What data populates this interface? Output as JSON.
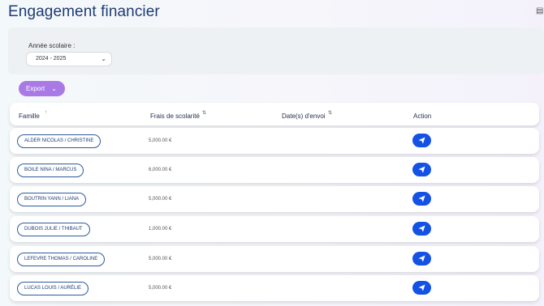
{
  "page": {
    "title": "Engagement financier"
  },
  "filters": {
    "year_label": "Année scolaire :",
    "year_value": "2024 - 2025"
  },
  "toolbar": {
    "export_label": "Export"
  },
  "table": {
    "headers": {
      "family": "Famille",
      "fees": "Frais de scolarité",
      "dates": "Date(s) d'envoi",
      "action": "Action"
    },
    "rows": [
      {
        "family": "ALDER NICOLAS / CHRISTINE",
        "fee": "5,000.00 €"
      },
      {
        "family": "BOILE NINA / MARCUS",
        "fee": "6,000.00 €"
      },
      {
        "family": "BOUTRIN YANN / LIANA",
        "fee": "5,000.00 €"
      },
      {
        "family": "DUBOIS JULIE / THIBAUT",
        "fee": "1,000.00 €"
      },
      {
        "family": "LEFEVRE THOMAS / CAROLINE",
        "fee": "5,000.00 €"
      },
      {
        "family": "LUCAS LOUIS / AURÉLIE",
        "fee": "5,000.00 €"
      }
    ]
  },
  "icons": {
    "sort": "sort-icon",
    "send": "paper-plane-icon",
    "dropdown": "chevron-down-icon"
  },
  "colors": {
    "title": "#1f3b73",
    "export": "#a97ae6",
    "send": "#1452e6"
  }
}
